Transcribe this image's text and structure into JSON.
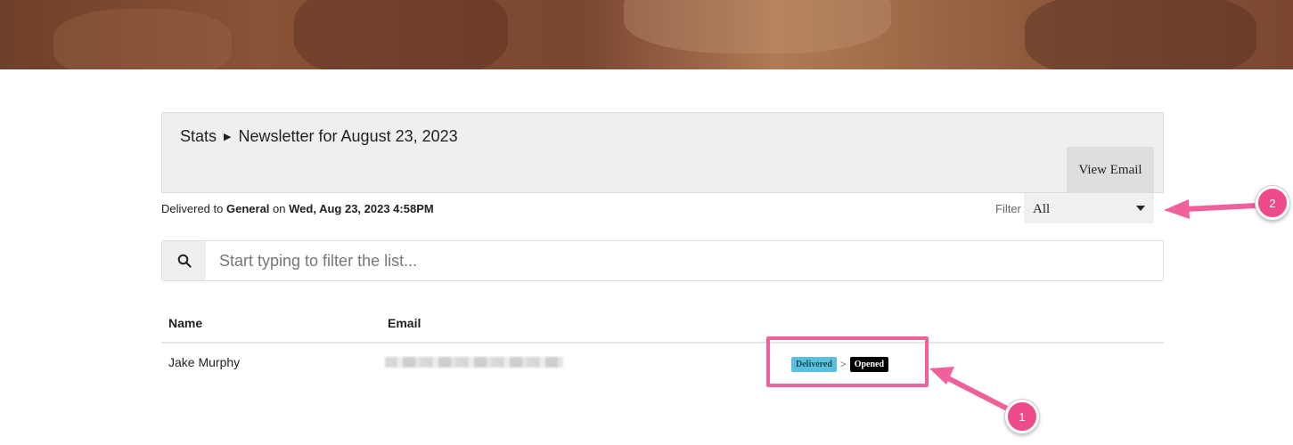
{
  "breadcrumb": {
    "root": "Stats",
    "current": "Newsletter for August 23, 2023"
  },
  "actions": {
    "view_email": "View Email"
  },
  "delivery": {
    "prefix": "Delivered to",
    "list": "General",
    "on": "on",
    "datetime": "Wed, Aug 23, 2023 4:58PM"
  },
  "filter": {
    "label": "Filter",
    "selected": "All"
  },
  "search": {
    "placeholder": "Start typing to filter the list..."
  },
  "table": {
    "headers": {
      "name": "Name",
      "email": "Email"
    },
    "rows": [
      {
        "name": "Jake Murphy",
        "status": {
          "delivered": "Delivered",
          "sep": ">",
          "opened": "Opened"
        }
      }
    ]
  },
  "annotations": {
    "marker1": "1",
    "marker2": "2"
  },
  "colors": {
    "highlight": "#f0609a",
    "marker": "#ef4b8a",
    "delivered_badge": "#5bc0de"
  }
}
